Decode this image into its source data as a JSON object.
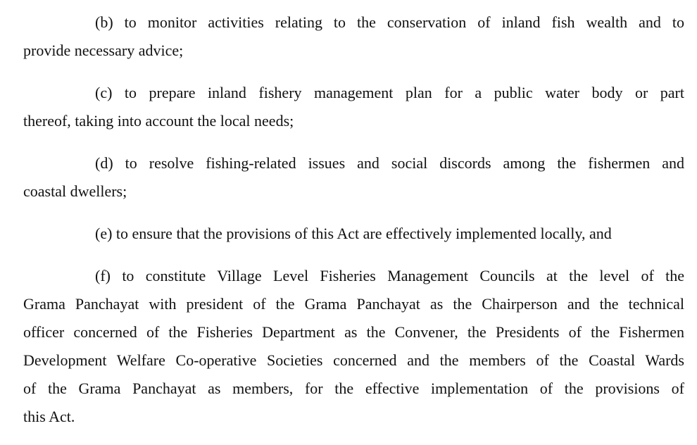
{
  "paragraphs": [
    {
      "lines": [
        "(b) to monitor activities relating to the conservation of inland fish wealth and to",
        "provide necessary advice;"
      ]
    },
    {
      "lines": [
        "(c) to prepare inland fishery management plan for a public  water body or part",
        "thereof, taking into account the local needs;"
      ]
    },
    {
      "lines": [
        "(d) to resolve fishing-related issues and social discords among the fishermen and",
        "coastal dwellers;"
      ]
    },
    {
      "lines": [
        "(e) to ensure that the provisions of this Act are effectively implemented locally, and"
      ]
    },
    {
      "lines": [
        "(f) to constitute Village Level Fisheries Management Councils at the level of the",
        "Grama Panchayat  with president of the Grama Panchayat as the Chairperson and the technical",
        "officer concerned of the Fisheries Department as the Convener, the Presidents of the Fishermen",
        "Development Welfare Co-operative Societies concerned and the members of the Coastal Wards",
        "of the Grama Panchayat as  members,  for the effective implementation of the provisions of",
        "this Act."
      ]
    }
  ]
}
